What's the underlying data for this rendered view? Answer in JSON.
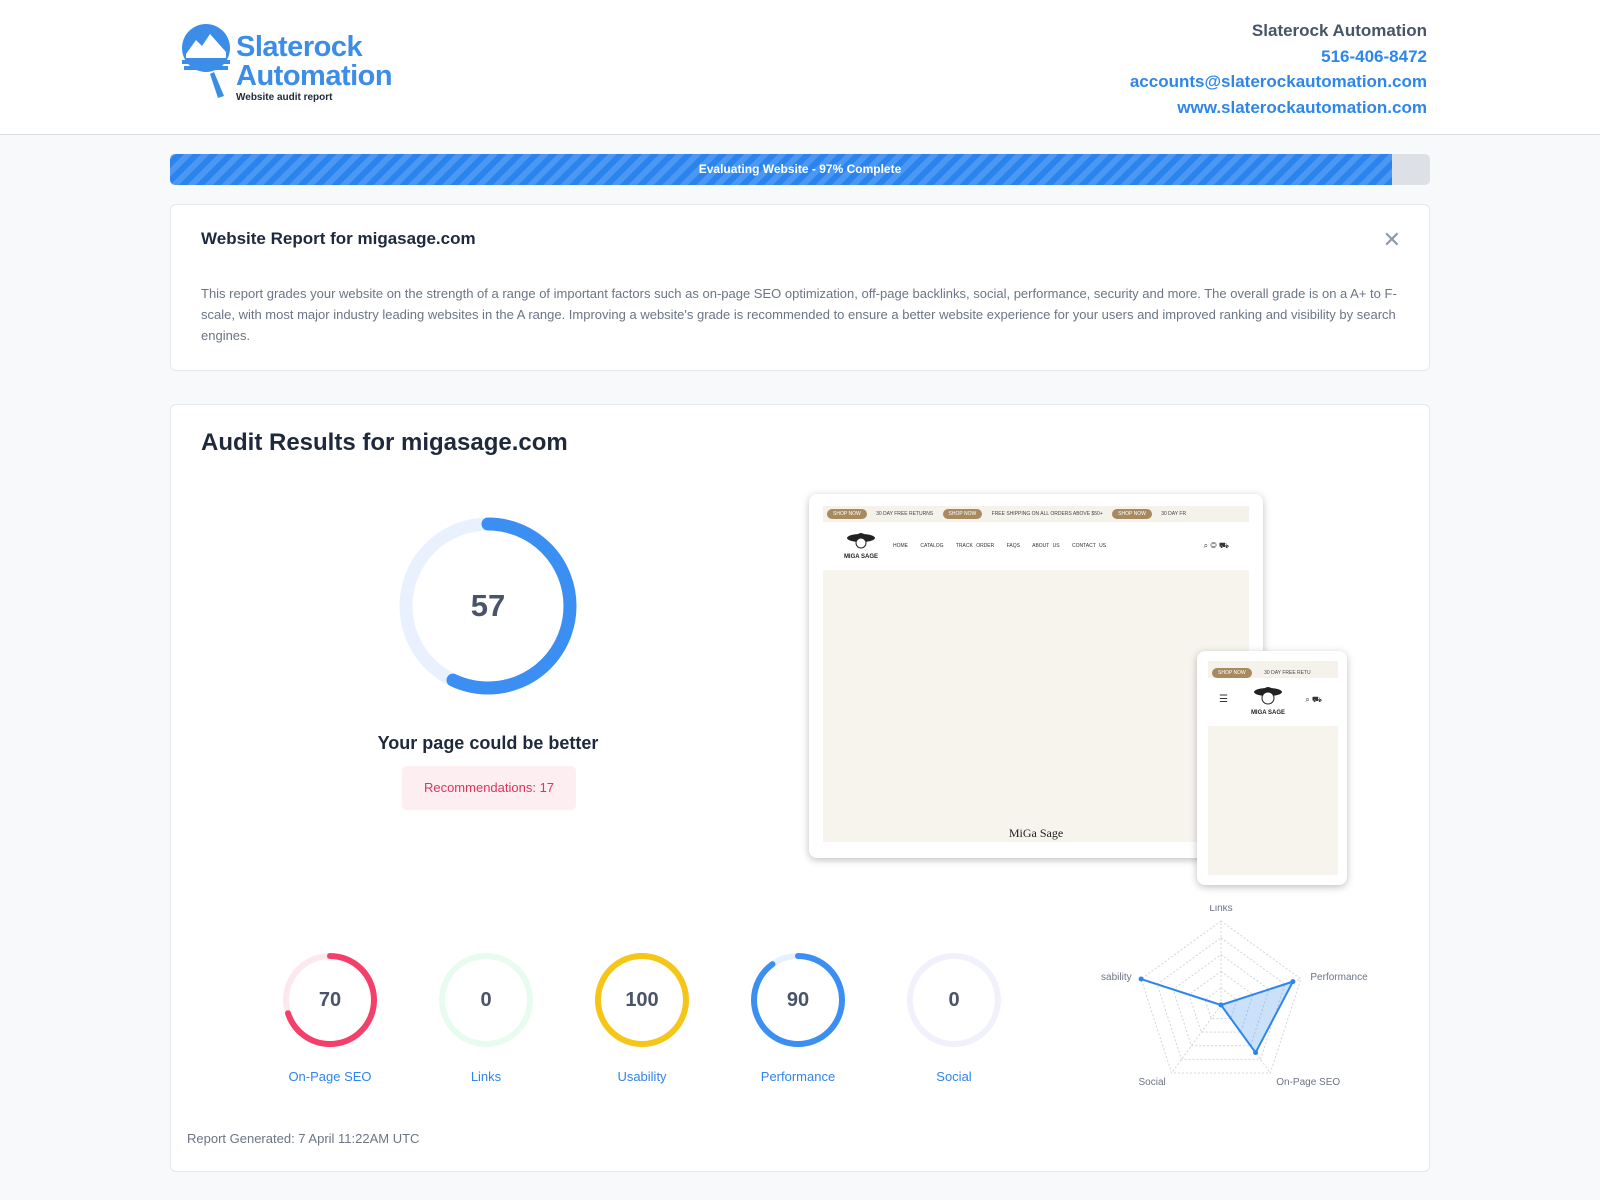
{
  "brand": {
    "line1": "Slaterock",
    "line2": "Automation",
    "subtitle": "Website audit report",
    "color": "#3b8de8"
  },
  "contact": {
    "company": "Slaterock Automation",
    "phone": "516-406-8472",
    "email": "accounts@slaterockautomation.com",
    "website": "www.slaterockautomation.com"
  },
  "progress": {
    "label": "Evaluating Website - 97% Complete",
    "percent": 97
  },
  "report": {
    "title": "Website Report for migasage.com",
    "close_icon": "close-icon",
    "description": "This report grades your website on the strength of a range of important factors such as on-page SEO optimization, off-page backlinks, social, performance, security and more. The overall grade is on a A+ to F-scale, with most major industry leading websites in the A range. Improving a website's grade is recommended to ensure a better website experience for your users and improved ranking and visibility by search engines."
  },
  "audit": {
    "title": "Audit Results for migasage.com",
    "score": "57",
    "score_value": 57,
    "verdict": "Your page could be better",
    "recommendations": "Recommendations: 17",
    "generated": "Report Generated: 7 April 11:22AM UTC"
  },
  "preview": {
    "desktop": {
      "banner": [
        "SHOP NOW",
        "30 DAY FREE RETURNS",
        "SHOP NOW",
        "FREE SHIPPING ON ALL ORDERS ABOVE $50+",
        "SHOP NOW",
        "30 DAY FR"
      ],
      "nav": [
        "HOME",
        "CATALOG",
        "TRACK ORDER",
        "FAQS",
        "ABOUT US",
        "CONTACT US"
      ],
      "logo_text": "MIGA SAGE",
      "hero_text": "MiGa Sage"
    },
    "mobile": {
      "banner": [
        "SHOP NOW",
        "30 DAY FREE RETU"
      ],
      "logo_text": "MIGA SAGE"
    }
  },
  "categories": [
    {
      "label": "On-Page SEO",
      "score": "70",
      "value": 70,
      "color": "#f43f6b",
      "track": "#fde8ed"
    },
    {
      "label": "Links",
      "score": "0",
      "value": 0,
      "color": "#22c55e",
      "track": "#e8fbef"
    },
    {
      "label": "Usability",
      "score": "100",
      "value": 100,
      "color": "#f5c518",
      "track": "#fdf6d8"
    },
    {
      "label": "Performance",
      "score": "90",
      "value": 90,
      "color": "#3b8ff3",
      "track": "#e7f0fd"
    },
    {
      "label": "Social",
      "score": "0",
      "value": 0,
      "color": "#8b5cf6",
      "track": "#f1f1fb"
    }
  ],
  "chart_data": {
    "type": "radar",
    "categories": [
      "Links",
      "Performance",
      "On-Page SEO",
      "Social",
      "Usability"
    ],
    "values": [
      0,
      90,
      70,
      0,
      100
    ],
    "range": [
      0,
      100
    ],
    "grid": true,
    "color": "#2f86ea"
  }
}
